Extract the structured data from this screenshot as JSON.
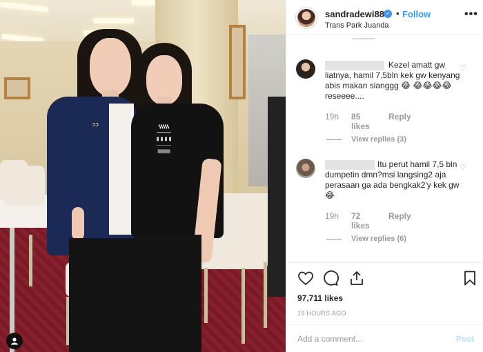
{
  "header": {
    "username": "sandradewi88",
    "verified_mark": "✓",
    "separator": "•",
    "follow_label": "Follow",
    "location": "Trans Park Juanda",
    "more_label": "•••"
  },
  "comments": [
    {
      "text": "Kezel amatt gw liatnya, hamil 7,5bln kek gw kenyang abis makan sianggg 😂 😂😂😂😂 reseeee....",
      "time": "19h",
      "likes": "85 likes",
      "reply_label": "Reply",
      "view_replies": "View replies (3)"
    },
    {
      "text": "Itu perut hamil 7,5 bln dumpetin dmn?msi langsing2 aja perasaan ga ada bengkak2'y kek gw 😂",
      "time": "19h",
      "likes": "72 likes",
      "reply_label": "Reply",
      "view_replies": "View replies (6)"
    }
  ],
  "post": {
    "likes_count": "97,711 likes",
    "timestamp": "19 HOURS AGO"
  },
  "add_comment": {
    "placeholder": "Add a comment...",
    "post_label": "Post"
  },
  "colors": {
    "accent": "#3897f0",
    "post_disabled": "#b2dffc",
    "muted": "#999999"
  },
  "icons": [
    "heart-icon",
    "comment-icon",
    "share-icon",
    "bookmark-icon",
    "more-icon",
    "verified-badge-icon",
    "instagram-user-icon"
  ]
}
